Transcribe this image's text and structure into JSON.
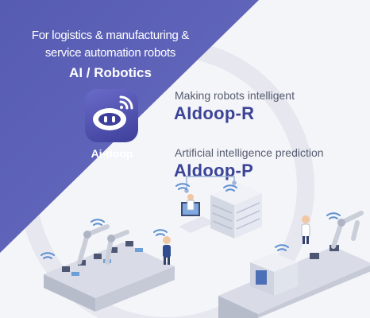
{
  "banner": {
    "tagline_line1": "For logistics & manufacturing &",
    "tagline_line2": "service automation robots",
    "category": "AI / Robotics",
    "colors": {
      "primary_panel": "#5d62b8",
      "title": "#3b4396",
      "subtitle": "#555b6e"
    }
  },
  "logo": {
    "icon": "robot-face-wifi-icon",
    "label": "Ai-doop"
  },
  "products": [
    {
      "subtitle": "Making robots intelligent",
      "name": "AIdoop-R"
    },
    {
      "subtitle": "Artificial intelligence prediction",
      "name": "AIdoop-P"
    }
  ],
  "illustration": {
    "icons": [
      "factory-conveyor-illustration",
      "server-rack-illustration",
      "wifi-icon",
      "robot-arm-illustration",
      "worker-illustration"
    ]
  }
}
